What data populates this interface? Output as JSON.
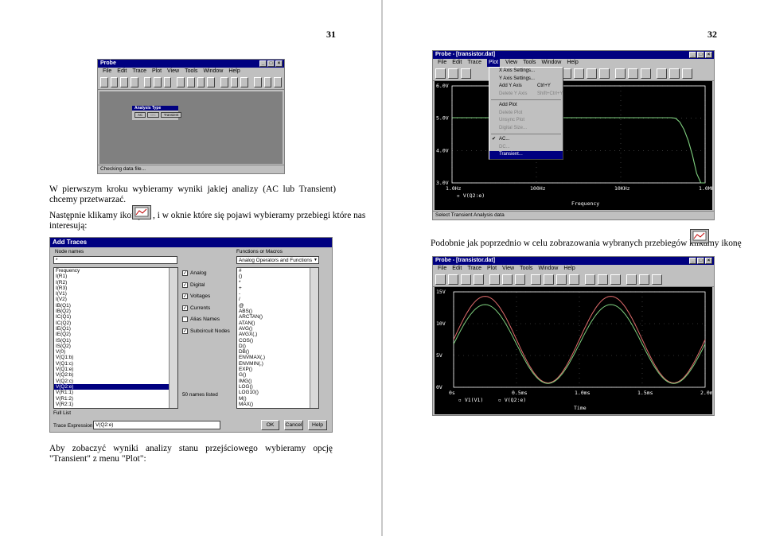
{
  "left_page": {
    "page_number": "31",
    "para1": "W pierwszym kroku wybieramy wyniki jakiej analizy (AC lub Transient) chcemy przetwarzać.",
    "para2_before_icon": "Następnie klikamy ikonę",
    "para2_after_icon": ", i w oknie które się pojawi wybieramy przebiegi które nas",
    "para2_line2": "interesują:",
    "probe_small": {
      "title": "Probe",
      "menu": [
        "File",
        "Edit",
        "Trace",
        "Plot",
        "View",
        "Tools",
        "Window",
        "Help"
      ],
      "status": "Checking data file...",
      "dialog_title": "Analysis Type",
      "dialog_buttons": [
        "AC",
        "DC",
        "Transient"
      ]
    },
    "add_traces": {
      "title": "Add Traces",
      "node_names_label": "Node names",
      "node_filter": "*",
      "nodes": [
        "Frequency",
        "I(R1)",
        "I(R2)",
        "I(R3)",
        "I(V1)",
        "I(V2)",
        "IB(Q1)",
        "IB(Q2)",
        "IC(Q1)",
        "IC(Q2)",
        "IE(Q1)",
        "IE(Q2)",
        "IS(Q1)",
        "IS(Q2)",
        "V(0)",
        "V(Q1:b)",
        "V(Q1:c)",
        "V(Q1:e)",
        "V(Q2:b)",
        "V(Q2:c)",
        "V(Q2:e)",
        "V(R1:1)",
        "V(R1:2)",
        "V(R2:1)"
      ],
      "selected_node": "V(Q2:e)",
      "checkboxes": [
        {
          "label": "Analog",
          "checked": true
        },
        {
          "label": "Digital",
          "checked": true
        },
        {
          "label": "Voltages",
          "checked": true
        },
        {
          "label": "Currents",
          "checked": true
        },
        {
          "label": "Alias Names",
          "checked": false
        },
        {
          "label": "Subcircuit Nodes",
          "checked": true
        }
      ],
      "names_listed": "50 names listed",
      "functions_label": "Functions or Macros",
      "functions_select": "Analog Operators and Functions",
      "functions": [
        "#",
        "()",
        "*",
        "+",
        "-",
        "/",
        "@",
        "ABS()",
        "ARCTAN()",
        "ATAN()",
        "AVG()",
        "AVGX(,)",
        "COS()",
        "D()",
        "DB()",
        "ENVMAX(,)",
        "ENVMIN(,)",
        "EXP()",
        "G()",
        "IMG()",
        "LOG()",
        "LOG10()",
        "M()",
        "MAX()"
      ],
      "full_list": "Full List",
      "trace_expression_label": "Trace Expression:",
      "trace_expression": "V(Q2:e)",
      "buttons": [
        "OK",
        "Cancel",
        "Help"
      ]
    }
  },
  "right_page": {
    "page_number": "32",
    "probe1": {
      "title": "Probe - [transistor.dat]",
      "menu": [
        "File",
        "Edit",
        "Trace",
        "Plot",
        "View",
        "Tools",
        "Window",
        "Help"
      ],
      "active_menu": "Plot",
      "plot_menu": [
        {
          "label": "X Axis Settings...",
          "shortcut": "",
          "state": "normal"
        },
        {
          "label": "Y Axis Settings...",
          "shortcut": "",
          "state": "normal"
        },
        {
          "label": "Add Y Axis",
          "shortcut": "Ctrl+Y",
          "state": "normal"
        },
        {
          "label": "Delete Y Axis",
          "shortcut": "Shift+Ctrl+Y",
          "state": "disabled"
        },
        {
          "label": "Add Plot",
          "shortcut": "",
          "state": "normal"
        },
        {
          "label": "Delete Plot",
          "shortcut": "",
          "state": "disabled"
        },
        {
          "label": "Unsync Plot",
          "shortcut": "",
          "state": "disabled"
        },
        {
          "label": "Digital Size...",
          "shortcut": "",
          "state": "disabled"
        },
        {
          "label": "AC...",
          "shortcut": "",
          "state": "checked"
        },
        {
          "label": "DC...",
          "shortcut": "",
          "state": "disabled"
        },
        {
          "label": "Transient...",
          "shortcut": "",
          "state": "highlighted"
        }
      ],
      "y_ticks": [
        "6.0V",
        "5.0V",
        "4.0V",
        "3.0V"
      ],
      "x_ticks": [
        "1.0Hz",
        "100Hz",
        "10KHz",
        "1.0MHz"
      ],
      "legend": "V(Q2:e)",
      "xlabel": "Frequency",
      "status": "Select Transient Analysis data"
    },
    "para3": "Podobnie jak poprzednio w celu zobrazowania wybranych przebiegów klikamy ikonę",
    "probe2": {
      "title": "Probe - [transistor.dat]",
      "menu": [
        "File",
        "Edit",
        "Trace",
        "Plot",
        "View",
        "Tools",
        "Window",
        "Help"
      ],
      "y_ticks": [
        "15V",
        "10V",
        "5V",
        "0V"
      ],
      "x_ticks": [
        "0s",
        "0.5ms",
        "1.0ms",
        "1.5ms",
        "2.0ms"
      ],
      "legend": [
        "V1(V1)",
        "V(Q2:e)"
      ],
      "xlabel": "Time"
    },
    "para4": "Aby zobaczyć wyniki analizy stanu przejściowego wybieramy opcję \"Transient\" z menu \"Plot\":"
  },
  "colors": {
    "plot_bg": "#000000",
    "trace_green": "#7fd07f",
    "trace_red": "#e06c6c",
    "title_blue": "#000080",
    "win_gray": "#c0c0c0"
  }
}
